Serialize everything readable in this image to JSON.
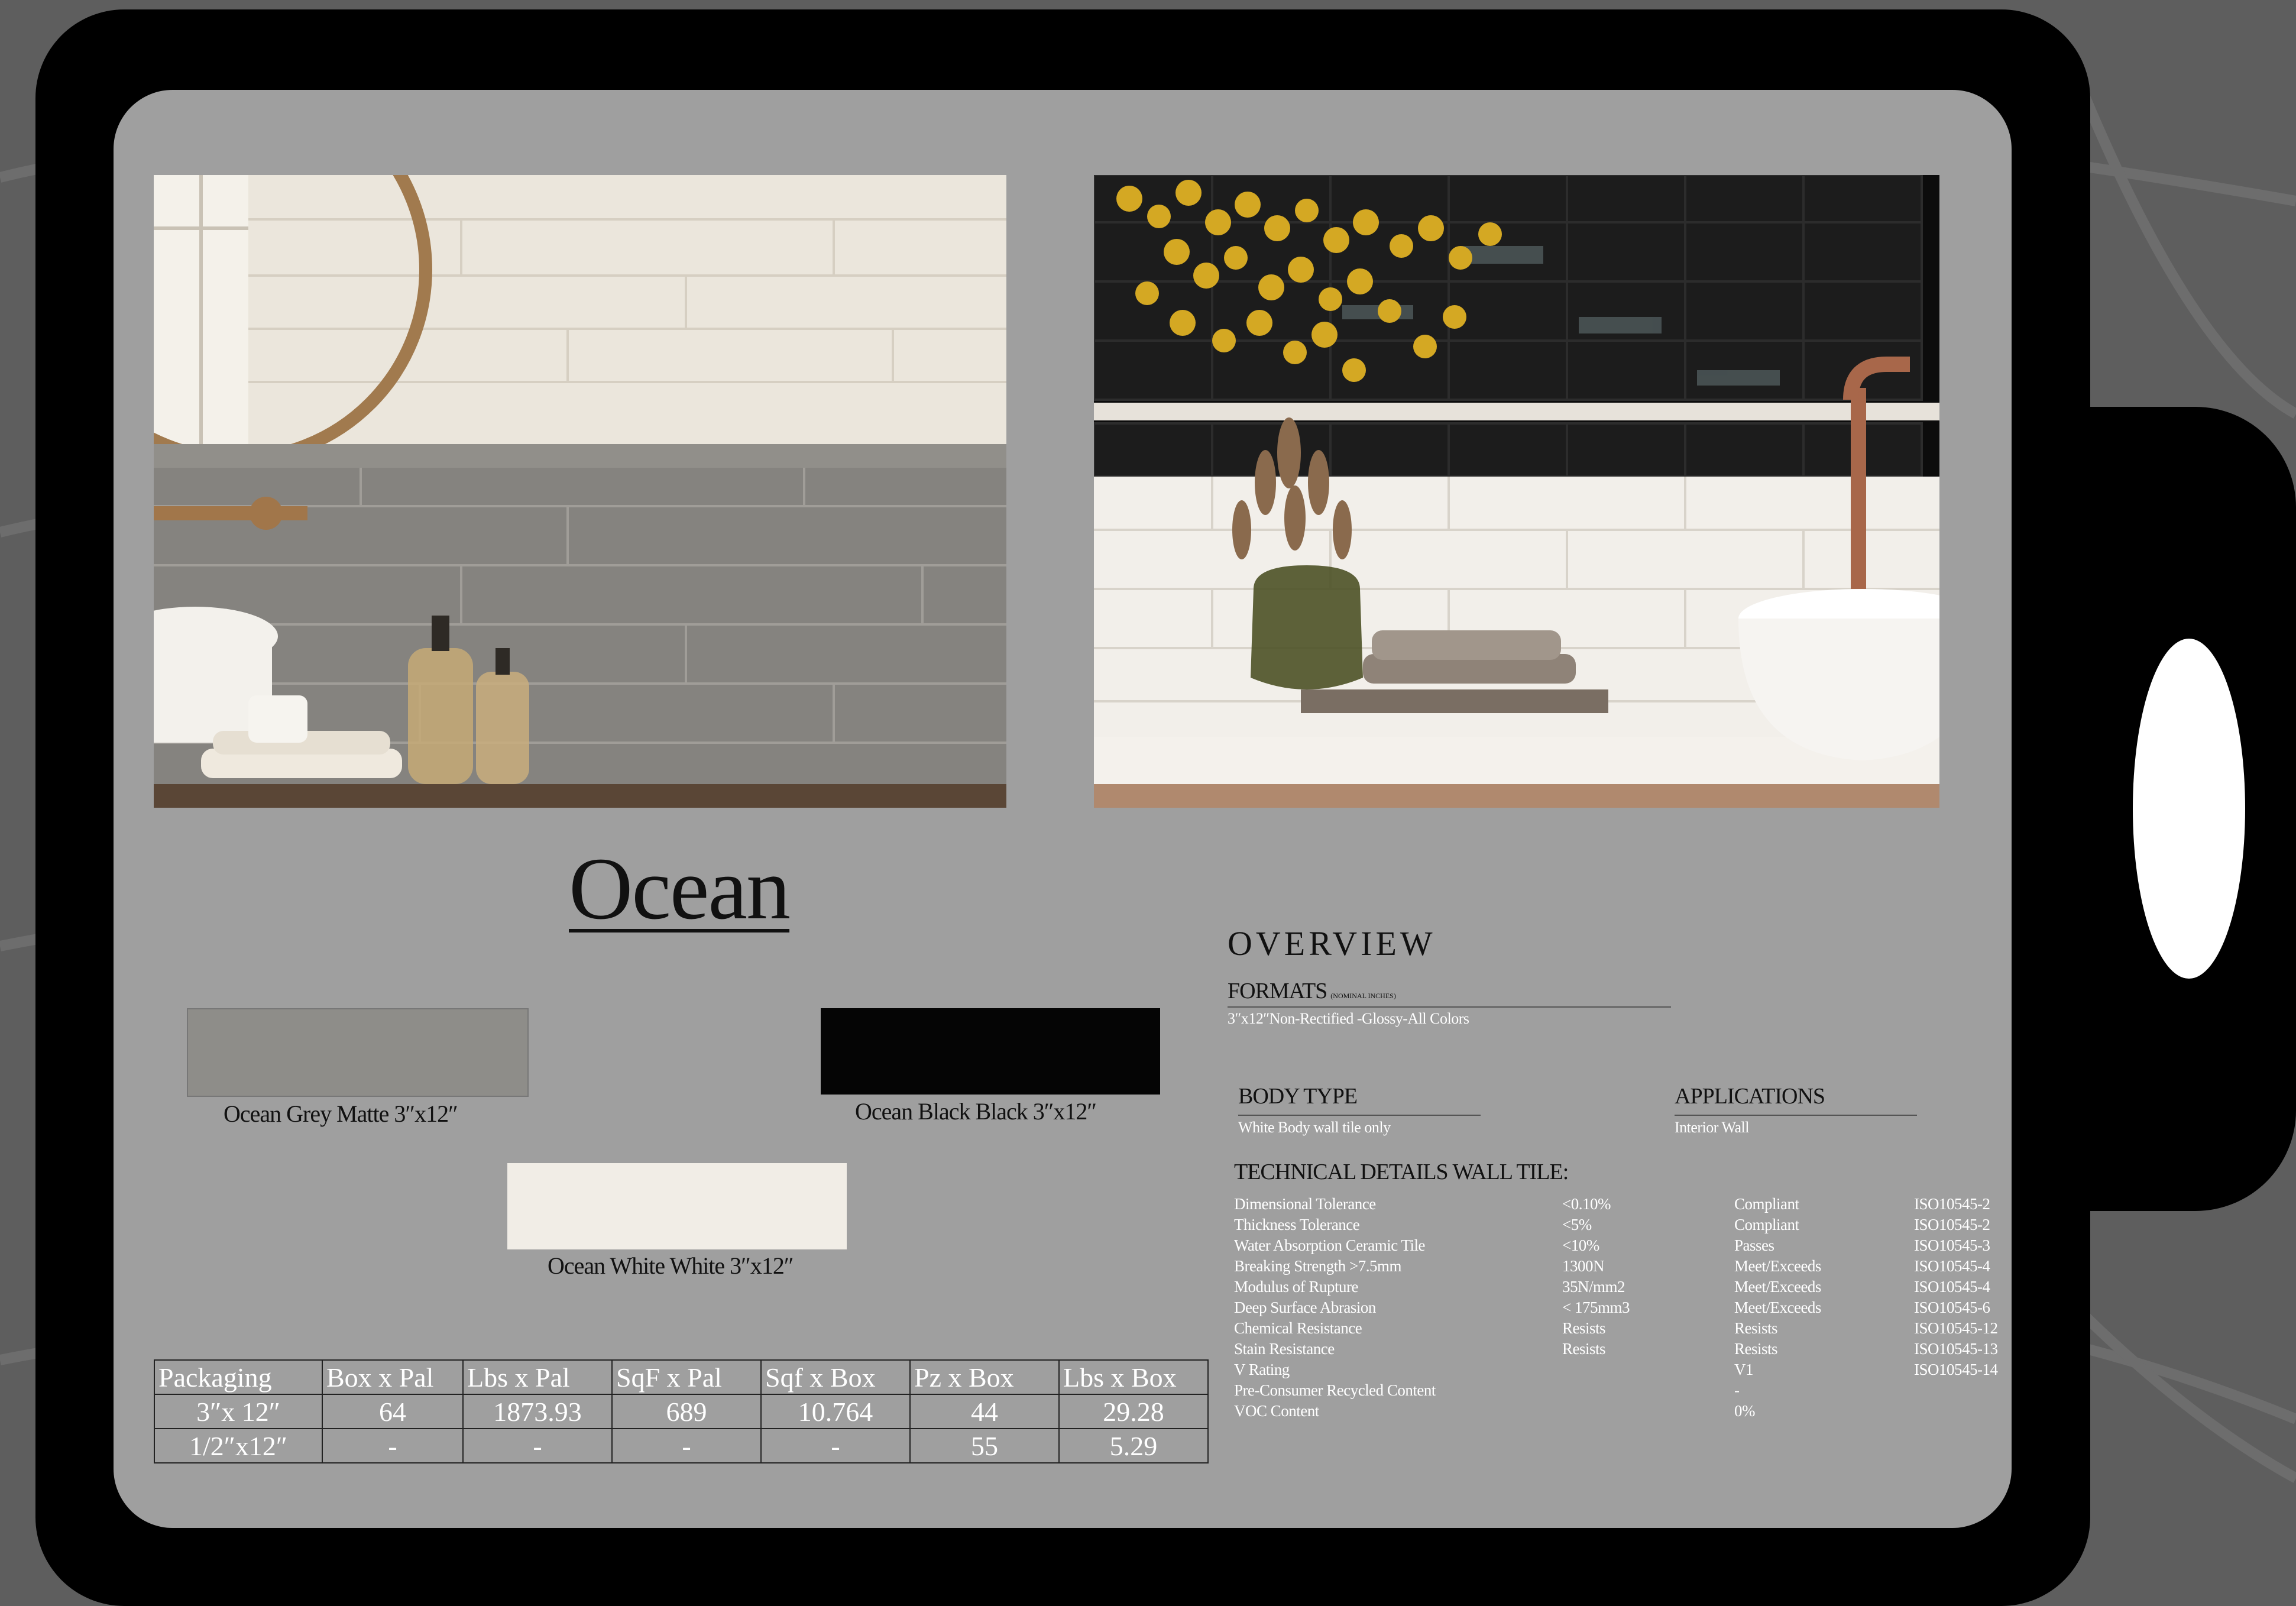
{
  "product": {
    "title": "Ocean"
  },
  "swatches": [
    {
      "label": "Ocean Grey Matte 3″x12″",
      "color": "#8e8d89"
    },
    {
      "label": "Ocean Black Black 3″x12″",
      "color": "#050505"
    },
    {
      "label": "Ocean White White 3″x12″",
      "color": "#f1ede6"
    }
  ],
  "packaging": {
    "headers": [
      "Packaging",
      "Box x Pal",
      "Lbs x Pal",
      "SqF x Pal",
      "Sqf x Box",
      "Pz x Box",
      "Lbs x Box"
    ],
    "rows": [
      [
        "3″x 12″",
        "64",
        "1873.93",
        "689",
        "10.764",
        "44",
        "29.28"
      ],
      [
        "1/2″x12″",
        "-",
        "-",
        "-",
        "-",
        "55",
        "5.29"
      ]
    ]
  },
  "overview": {
    "title": "OVERVIEW",
    "formats_label": "FORMATS",
    "formats_note": "(NOMINAL INCHES)",
    "formats_text": "3″x12″Non-Rectified -Glossy-All Colors",
    "body_type_label": "BODY TYPE",
    "body_type_text": "White Body wall tile only",
    "applications_label": "APPLICATIONS",
    "applications_text": "Interior Wall"
  },
  "technical": {
    "title": "TECHNICAL DETAILS WALL TILE:",
    "rows": [
      [
        "Dimensional Tolerance",
        "<0.10%",
        "Compliant",
        "ISO10545-2"
      ],
      [
        "Thickness Tolerance",
        "<5%",
        "Compliant",
        "ISO10545-2"
      ],
      [
        "Water Absorption Ceramic Tile",
        "<10%",
        "Passes",
        "ISO10545-3"
      ],
      [
        "Breaking Strength >7.5mm",
        "1300N",
        "Meet/Exceeds",
        "ISO10545-4"
      ],
      [
        "Modulus of Rupture",
        "35N/mm2",
        "Meet/Exceeds",
        "ISO10545-4"
      ],
      [
        "Deep Surface   Abrasion",
        "< 175mm3",
        "Meet/Exceeds",
        "ISO10545-6"
      ],
      [
        "Chemical Resistance",
        "Resists",
        "Resists",
        "ISO10545-12"
      ],
      [
        "Stain Resistance",
        "Resists",
        "Resists",
        "ISO10545-13"
      ],
      [
        "V Rating",
        "",
        "V1",
        "ISO10545-14"
      ],
      [
        "Pre-Consumer Recycled Content",
        "",
        "-",
        ""
      ],
      [
        "VOC Content",
        "",
        "0%",
        ""
      ]
    ]
  },
  "colors": {
    "panel": "#9f9f9f",
    "frame": "#000000",
    "background": "#5f5f5f"
  }
}
